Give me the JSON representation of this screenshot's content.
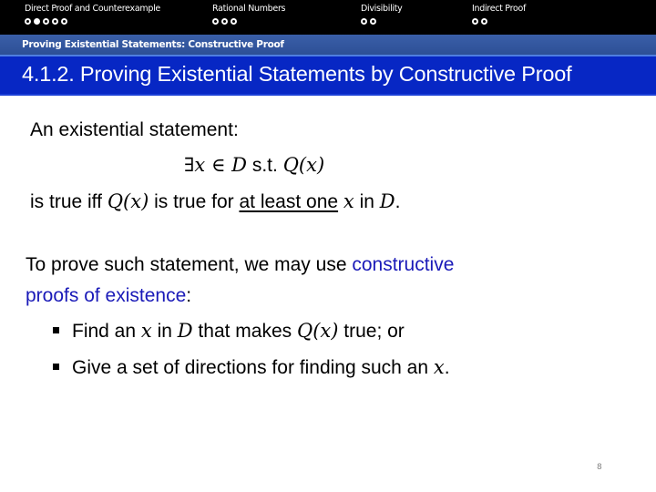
{
  "navigation": {
    "sections": [
      {
        "label": "Direct Proof and Counterexample",
        "dots": 5,
        "active_dot": 2
      },
      {
        "label": "Rational Numbers",
        "dots": 3,
        "active_dot": 0
      },
      {
        "label": "Divisibility",
        "dots": 2,
        "active_dot": 0
      },
      {
        "label": "Indirect Proof",
        "dots": 2,
        "active_dot": 0
      }
    ]
  },
  "subsection": {
    "title": "Proving Existential Statements: Constructive Proof"
  },
  "slide": {
    "title": "4.1.2. Proving Existential Statements by Constructive Proof",
    "page_number": "8"
  },
  "body": {
    "intro": "An existential statement:",
    "formula": {
      "exists": "∃",
      "x": "x",
      "in": " ∈ ",
      "D": "D",
      "st": " s.t. ",
      "Qx": "Q(x)"
    },
    "truth_line": {
      "part1": "is true iff ",
      "Qx": "Q(x)",
      "part2": " is true for ",
      "underlined": "at least one",
      "part3": " ",
      "x": "x",
      "part4": " in ",
      "D": "D",
      "part5": "."
    },
    "prove_line": {
      "part1": "To prove such statement, we may use ",
      "highlight1": "constructive",
      "highlight2": "proofs of existence",
      "part2": ":"
    },
    "bullets": [
      {
        "part1": "Find an ",
        "x": "x",
        "part2": " in ",
        "D": "D",
        "part3": " that makes ",
        "Qx": "Q(x)",
        "part4": " true; or"
      },
      {
        "part1": "Give a set of directions for finding such an ",
        "x": "x",
        "part2": "."
      }
    ]
  },
  "colors": {
    "nav_bg": "#000000",
    "subsection_bg": "#3a5fa8",
    "title_bg": "#0727c4",
    "highlight_text": "#1a1ab8"
  }
}
